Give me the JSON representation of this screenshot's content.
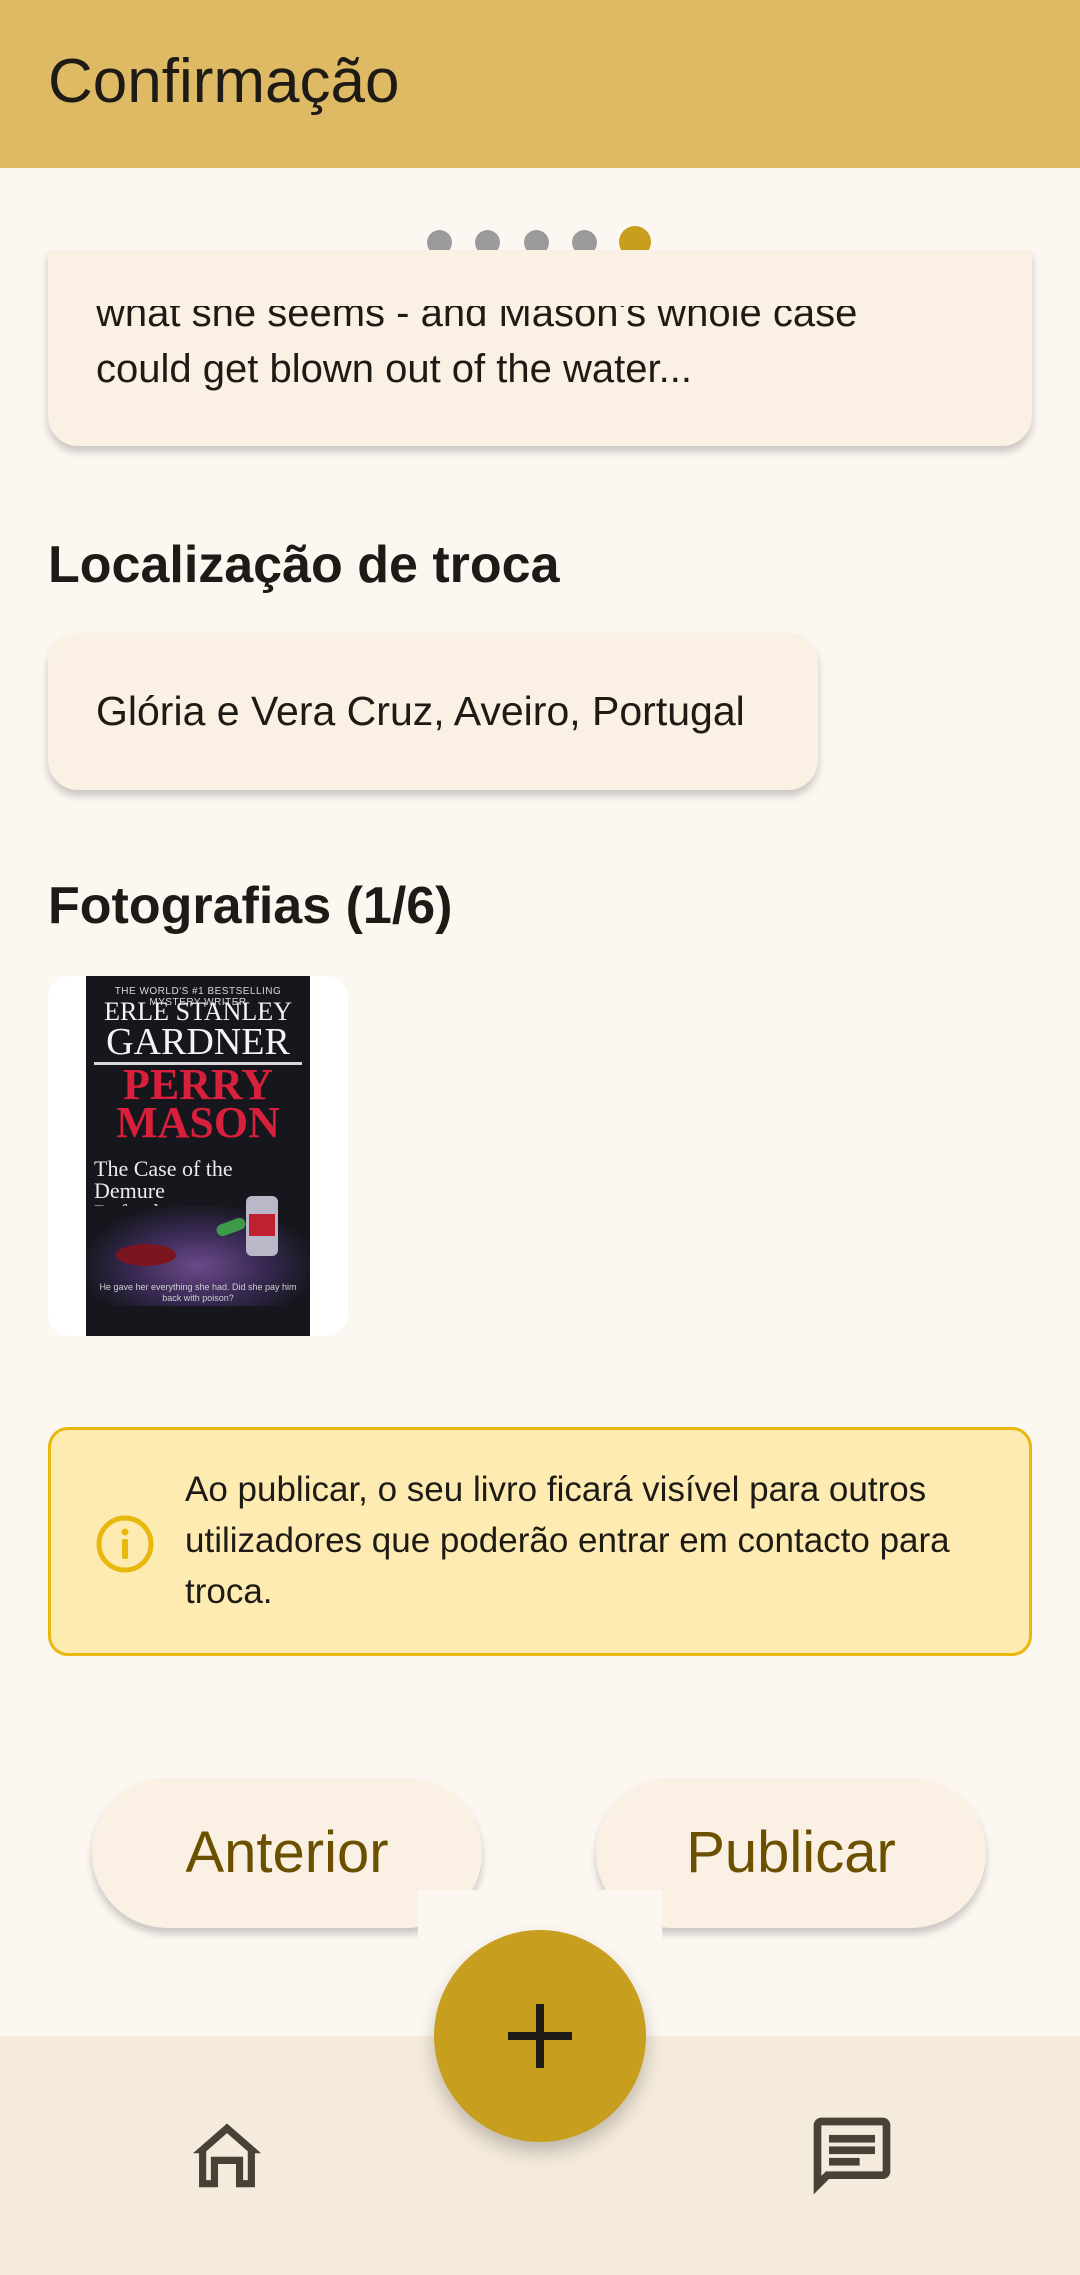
{
  "app_bar": {
    "title": "Confirmação"
  },
  "stepper": {
    "total": 5,
    "current": 5,
    "active_color": "#C89E1E",
    "inactive_color": "#9B9B9B"
  },
  "description": {
    "clipped_line": "what she seems - and Mason's whole case",
    "last_line": "could get blown out of the water..."
  },
  "location": {
    "heading": "Localização de troca",
    "value": "Glória e Vera Cruz, Aveiro, Portugal"
  },
  "photos": {
    "heading": "Fotografias (1/6)",
    "cover": {
      "top_line": "THE WORLD'S #1 BESTSELLING MYSTERY WRITER",
      "author_first": "ERLE STANLEY",
      "author_last": "GARDNER",
      "series_1": "PERRY",
      "series_2": "MASON",
      "series_tag": "MYSTERY",
      "title": "The Case of the Demure Defendant",
      "tagline": "He gave her everything she had. Did she pay him back with poison?"
    }
  },
  "info": {
    "icon": "info-icon",
    "text": "Ao publicar, o seu livro ficará visível para outros utilizadores que poderão entrar em contacto para troca."
  },
  "actions": {
    "previous_label": "Anterior",
    "publish_label": "Publicar"
  },
  "fab": {
    "icon": "plus-icon"
  },
  "bottom_nav": {
    "left_icon": "home-icon",
    "right_icon": "chat-icon"
  },
  "colors": {
    "app_bar": "#DDBA63",
    "background": "#FDF7F2",
    "card": "#FAF0E3",
    "accent": "#C89E1E",
    "button_text": "#6B5000",
    "info_bg": "#FEEBB1",
    "info_border": "#E9B80E"
  }
}
